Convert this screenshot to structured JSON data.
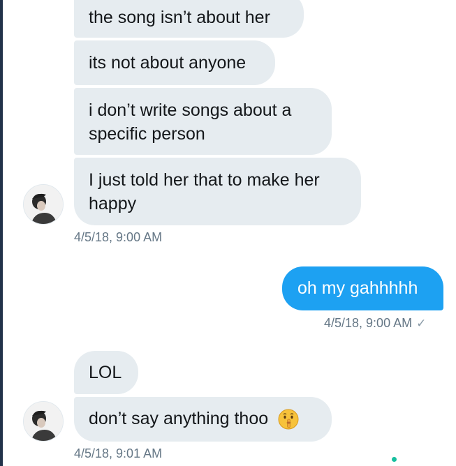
{
  "conversation": {
    "messages": [
      {
        "text": "the song isn’t about her",
        "direction": "incoming"
      },
      {
        "text": "its not about anyone",
        "direction": "incoming"
      },
      {
        "lines": [
          "i don’t write songs about a",
          "specific person"
        ],
        "direction": "incoming"
      },
      {
        "lines": [
          "I just told her that to make her",
          "happy"
        ],
        "direction": "incoming"
      },
      {
        "text": "oh my gahhhhh",
        "direction": "outgoing"
      },
      {
        "text": "LOL",
        "direction": "incoming"
      },
      {
        "text": "don’t say anything thoo",
        "emoji": "shushing-face",
        "direction": "incoming"
      }
    ],
    "timestamps": {
      "group1": "4/5/18, 9:00 AM",
      "outgoing": "4/5/18, 9:00 AM",
      "group2": "4/5/18, 9:01 AM"
    },
    "read_receipt_icon": "checkmark-icon"
  },
  "colors": {
    "incoming_bubble": "#e6ecf0",
    "outgoing_bubble": "#1da1f2",
    "timestamp": "#657786",
    "online_dot": "#17bf9f"
  }
}
